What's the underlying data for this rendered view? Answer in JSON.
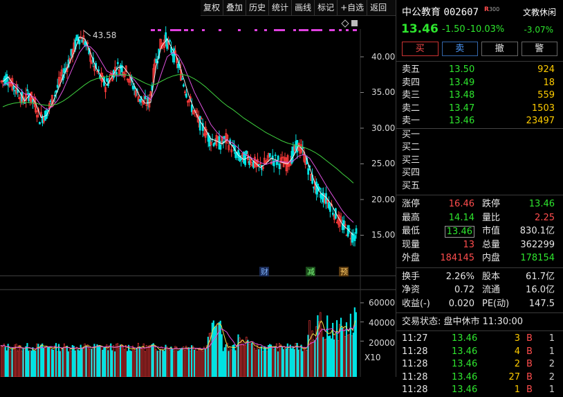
{
  "toolbar": {
    "items": [
      "复权",
      "叠加",
      "历史",
      "统计",
      "画线",
      "标记",
      "+自选",
      "返回"
    ]
  },
  "chart": {
    "high_marker": "43.58",
    "price_axis": [
      "40.00",
      "35.00",
      "30.00",
      "25.00",
      "20.00",
      "15.00"
    ],
    "volume_axis": [
      "60000",
      "40000",
      "20000"
    ],
    "volume_unit": "X10",
    "event_tags": [
      "财",
      "减",
      "预"
    ],
    "chart_data": {
      "type": "line",
      "title": "",
      "ylim": [
        12,
        44
      ],
      "series": [
        {
          "values": [
            36.5,
            37.2,
            36.0,
            35.2,
            33.8,
            34.8,
            33.5,
            31.5,
            31.8,
            33.4,
            35.2,
            37.2,
            38.8,
            40.6,
            42.8,
            42.5,
            40.6,
            38.5,
            37.2,
            36.0,
            37.3,
            38.5,
            38.6,
            37.6,
            36.0,
            34.5,
            33.5,
            33.6,
            38.7,
            41.5,
            42.5,
            41.0,
            39.5,
            37.0,
            34.5,
            32.5,
            31.0,
            29.8,
            28.5,
            28.2,
            27.8,
            28.4,
            27.4,
            26.2,
            25.6,
            26.0,
            25.2,
            24.5,
            25.0,
            25.8,
            25.5,
            25.2,
            25.0,
            26.0,
            27.6,
            26.7,
            24.5,
            22.2,
            20.9,
            20.3,
            19.3,
            17.8,
            16.5,
            15.8,
            15.0
          ]
        },
        {
          "values": [
            36.0,
            36.4,
            36.3,
            35.6,
            34.8,
            34.6,
            34.2,
            33.2,
            32.6,
            33.0,
            33.9,
            35.3,
            37.1,
            38.9,
            40.6,
            41.6,
            41.4,
            40.6,
            39.3,
            38.0,
            37.6,
            37.3,
            37.5,
            37.4,
            36.8,
            35.8,
            34.6,
            34.0,
            35.5,
            37.8,
            40.0,
            40.6,
            40.2,
            38.8,
            36.9,
            35.0,
            33.5,
            32.0,
            30.5,
            29.5,
            28.7,
            28.3,
            27.9,
            27.2,
            26.4,
            26.0,
            25.6,
            25.2,
            24.9,
            25.2,
            25.4,
            25.3,
            25.2,
            25.4,
            26.1,
            26.3,
            25.8,
            24.6,
            23.3,
            22.0,
            20.8,
            19.6,
            18.4,
            17.5,
            16.8
          ]
        },
        {
          "values": [
            33.0,
            33.3,
            33.5,
            33.6,
            33.6,
            33.6,
            33.5,
            33.3,
            33.2,
            33.2,
            33.4,
            33.8,
            34.3,
            34.9,
            35.5,
            36.1,
            36.6,
            36.9,
            37.1,
            37.2,
            37.4,
            37.5,
            37.5,
            37.4,
            37.1,
            36.7,
            36.3,
            36.0,
            36.2,
            36.6,
            37.0,
            37.3,
            37.5,
            37.5,
            37.3,
            36.9,
            36.4,
            35.8,
            35.1,
            34.4,
            33.7,
            33.1,
            32.6,
            32.0,
            31.4,
            30.9,
            30.4,
            29.9,
            29.4,
            29.0,
            28.6,
            28.2,
            27.9,
            27.7,
            27.5,
            27.3,
            27.0,
            26.6,
            26.1,
            25.5,
            24.9,
            24.3,
            23.6,
            23.0,
            22.3
          ]
        }
      ]
    }
  },
  "quote": {
    "name": "中公教育",
    "code": "002607",
    "r_badge": "R",
    "r_badge_sub": "300",
    "sector": "文教休闲",
    "price": "13.46",
    "change": "-1.50",
    "change_pct": "-10.03%",
    "sector_pct": "-3.07%"
  },
  "trade_buttons": [
    "买",
    "卖",
    "撤",
    "警"
  ],
  "order_book": {
    "asks": [
      {
        "label": "卖五",
        "price": "13.50",
        "vol": "924"
      },
      {
        "label": "卖四",
        "price": "13.49",
        "vol": "18"
      },
      {
        "label": "卖三",
        "price": "13.48",
        "vol": "559"
      },
      {
        "label": "卖二",
        "price": "13.47",
        "vol": "1503"
      },
      {
        "label": "卖一",
        "price": "13.46",
        "vol": "23497"
      }
    ],
    "bids": [
      {
        "label": "买一"
      },
      {
        "label": "买二"
      },
      {
        "label": "买三"
      },
      {
        "label": "买四"
      },
      {
        "label": "买五"
      }
    ]
  },
  "stats": [
    {
      "k1": "涨停",
      "v1": "16.46",
      "c1": "red",
      "k2": "跌停",
      "v2": "13.46",
      "c2": "green"
    },
    {
      "k1": "最高",
      "v1": "14.14",
      "c1": "green",
      "k2": "量比",
      "v2": "2.25",
      "c2": "red"
    },
    {
      "k1": "最低",
      "v1": "13.46",
      "c1": "green",
      "k2": "市值",
      "v2": "830.1亿",
      "c2": "white"
    },
    {
      "k1": "现量",
      "v1": "13",
      "c1": "red",
      "k2": "总量",
      "v2": "362299",
      "c2": "white"
    },
    {
      "k1": "外盘",
      "v1": "184145",
      "c1": "red",
      "k2": "内盘",
      "v2": "178154",
      "c2": "green"
    }
  ],
  "stats2": [
    {
      "k1": "换手",
      "v1": "2.26%",
      "k2": "股本",
      "v2": "61.7亿"
    },
    {
      "k1": "净资",
      "v1": "0.72",
      "k2": "流通",
      "v2": "16.0亿"
    },
    {
      "k1": "收益(-)",
      "v1": "0.020",
      "k2": "PE(动)",
      "v2": "147.5"
    }
  ],
  "trade_status": "交易状态: 盘中休市 11:30:00",
  "ticks": [
    {
      "time": "11:27",
      "price": "13.46",
      "vol": "3",
      "side": "B",
      "n": "1"
    },
    {
      "time": "11:28",
      "price": "13.46",
      "vol": "4",
      "side": "B",
      "n": "1"
    },
    {
      "time": "11:28",
      "price": "13.46",
      "vol": "2",
      "side": "B",
      "n": "2"
    },
    {
      "time": "11:28",
      "price": "13.46",
      "vol": "27",
      "side": "B",
      "n": "2"
    },
    {
      "time": "11:28",
      "price": "13.46",
      "vol": "1",
      "side": "B",
      "n": "1"
    }
  ],
  "colors": {
    "up": "#ff3b3b",
    "down": "#00e5e5",
    "ma5": "#f0f0f0",
    "ma10": "#e052e0",
    "ma30": "#3fd13f",
    "vol_ma": "#f0e04a",
    "marker_magenta": "#e040e0"
  }
}
